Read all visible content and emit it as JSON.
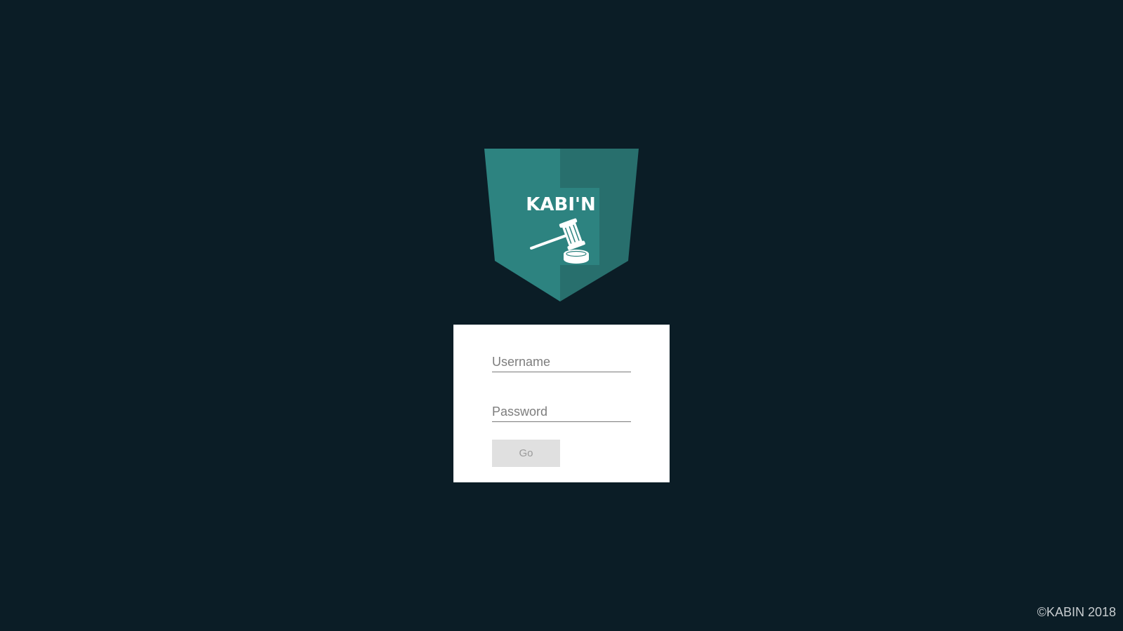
{
  "logo": {
    "text": "KABI'N",
    "icon": "gavel-icon",
    "colors": {
      "shield_left": "#2d8380",
      "shield_right": "#286f6d",
      "text": "#ffffff"
    }
  },
  "login": {
    "username_placeholder": "Username",
    "password_placeholder": "Password",
    "username_value": "",
    "password_value": "",
    "submit_label": "Go"
  },
  "footer": {
    "copyright": "©KABIN 2018"
  },
  "colors": {
    "background": "#0b1d26",
    "card": "#ffffff",
    "button_bg": "#e0e0e0",
    "button_text": "#9a9a9a"
  }
}
